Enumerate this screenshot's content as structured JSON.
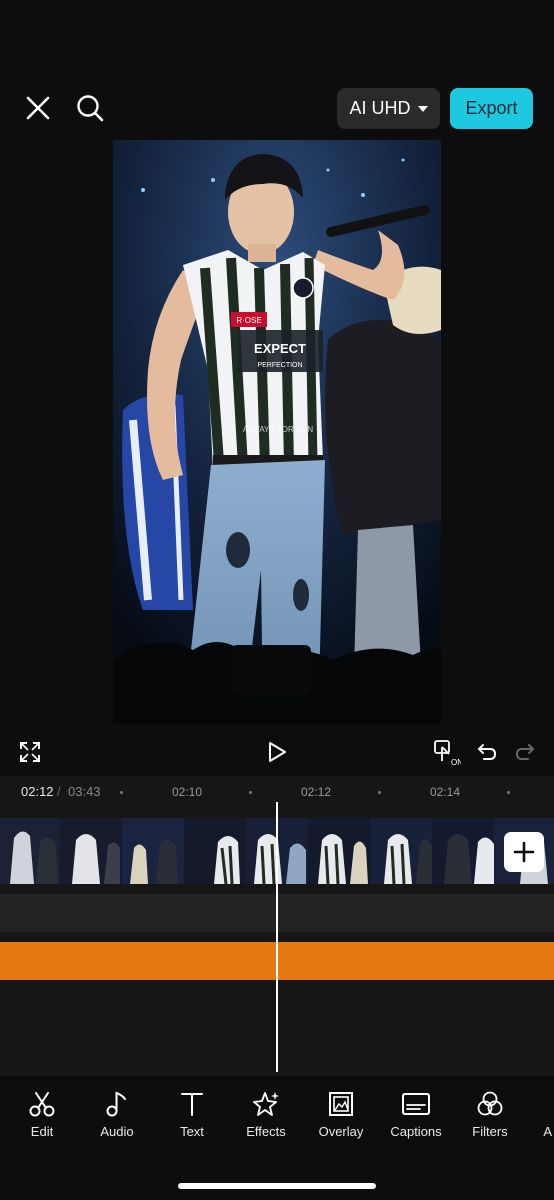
{
  "header": {
    "quality_label": "AI UHD",
    "export_label": "Export"
  },
  "preview": {
    "jersey_text": "EXPECT",
    "jersey_subtext": "PERFECTION",
    "patch_text": "R·OSE",
    "watermark": "ALWAYS FORWON"
  },
  "timeline": {
    "current_time": "02:12",
    "separator": "/",
    "total_time": "03:43",
    "ticks": [
      "02:10",
      "02:12",
      "02:14"
    ]
  },
  "toolbar": {
    "items": [
      {
        "label": "Edit"
      },
      {
        "label": "Audio"
      },
      {
        "label": "Text"
      },
      {
        "label": "Effects"
      },
      {
        "label": "Overlay"
      },
      {
        "label": "Captions"
      },
      {
        "label": "Filters"
      },
      {
        "label": "A"
      }
    ]
  },
  "colors": {
    "accent": "#1ec8e0",
    "audio_track": "#e67811",
    "background": "#0d0d0d"
  }
}
